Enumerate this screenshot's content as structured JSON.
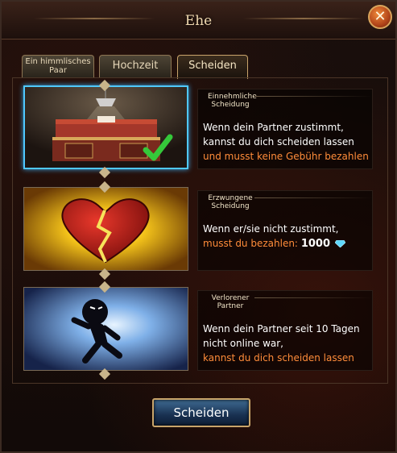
{
  "window": {
    "title": "Ehe",
    "close_label": "✕"
  },
  "tabs": [
    {
      "label": "Ein himmlisches Paar",
      "active": false
    },
    {
      "label": "Hochzeit",
      "active": false
    },
    {
      "label": "Scheiden",
      "active": true
    }
  ],
  "options": [
    {
      "title": "Einnehmliche Scheidung",
      "line1": "Wenn dein Partner zustimmt, kannst du dich scheiden lassen",
      "line2": "und musst keine Gebühr bezahlen",
      "selected": true,
      "image": "desk-with-lamp-image"
    },
    {
      "title": "Erzwungene Scheidung",
      "line1": "Wenn er/sie nicht zustimmt,",
      "line2": "musst du bezahlen:",
      "cost": "1000",
      "cost_icon": "diamond-icon",
      "selected": false,
      "image": "broken-heart-image"
    },
    {
      "title": "Verlorener Partner",
      "line1": "Wenn dein Partner seit 10 Tagen nicht online war,",
      "line2": "kannst du dich scheiden lassen",
      "selected": false,
      "image": "fleeing-figure-image"
    }
  ],
  "button": {
    "label": "Scheiden"
  },
  "colors": {
    "highlight": "#ff8c3a",
    "selection_border": "#4fc8ff",
    "title_text": "#f0d9b0"
  }
}
